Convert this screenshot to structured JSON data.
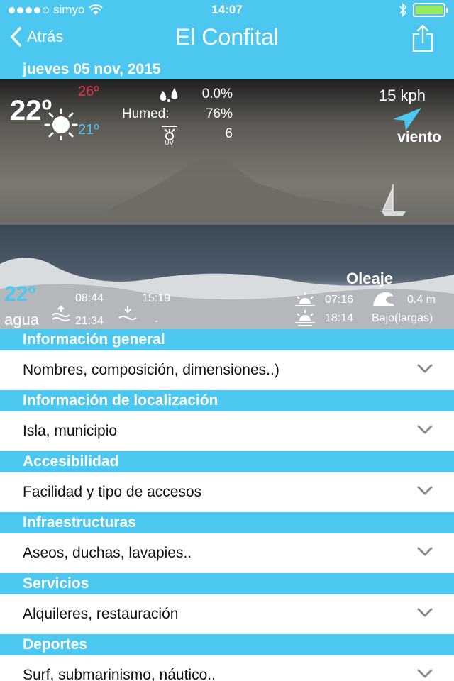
{
  "status": {
    "carrier": "simyo",
    "time": "14:07"
  },
  "nav": {
    "back_label": "Atrás",
    "title": "El Confital"
  },
  "date": "jueves 05 nov, 2015",
  "weather": {
    "temp": "22º",
    "temp_max": "26º",
    "temp_min": "21º",
    "rain": "0.0%",
    "humidity_label": "Humed:",
    "humidity": "76%",
    "uv": "6",
    "wind_speed": "15 kph",
    "wind_label": "viento",
    "water_temp": "22º",
    "water_label": "agua",
    "high_tide_1": "08:44",
    "high_tide_2": "15:19",
    "low_tide_1": "21:34",
    "low_tide_2": "-",
    "sunrise": "07:16",
    "sunset": "18:14",
    "swell_label": "Oleaje",
    "swell_height": "0.4 m",
    "swell_desc": "Bajo(largas)"
  },
  "sections": [
    {
      "header": "Información general",
      "row": "Nombres, composición, dimensiones..)"
    },
    {
      "header": "Información de localización",
      "row": "Isla, municipio"
    },
    {
      "header": "Accesibilidad",
      "row": "Facilidad y tipo de accesos"
    },
    {
      "header": "Infraestructuras",
      "row": "Aseos, duchas, lavapies.."
    },
    {
      "header": "Servicios",
      "row": "Alquileres, restauración"
    },
    {
      "header": "Deportes",
      "row": "Surf, submarinismo, náutico.."
    }
  ],
  "colors": {
    "accent": "#4cc8f0",
    "max_temp": "#e2354b",
    "battery": "#9bea5a"
  },
  "battery_level": 1.0
}
